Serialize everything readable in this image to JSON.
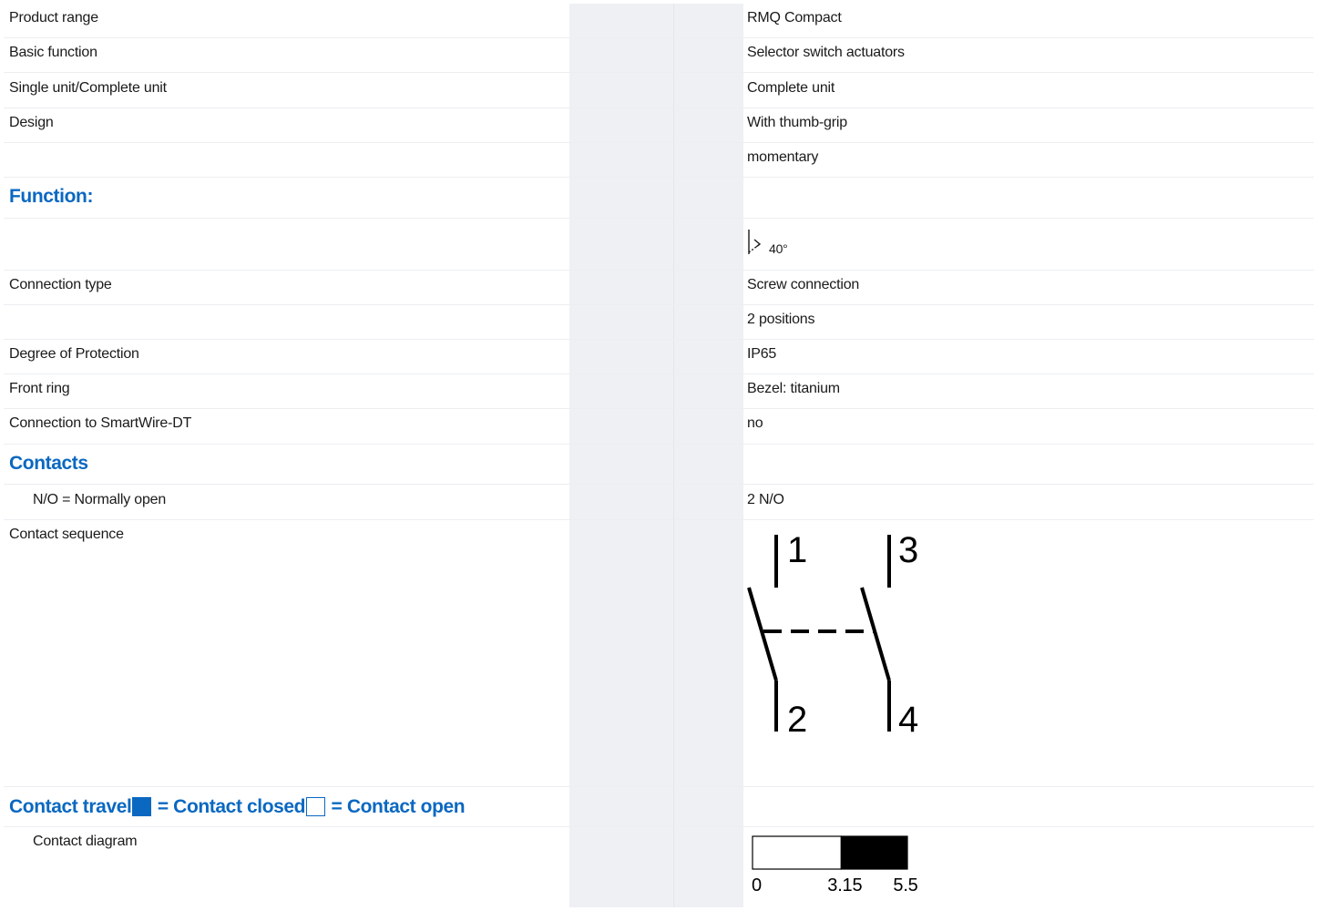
{
  "rows": {
    "product_range": {
      "label": "Product range",
      "value": "RMQ Compact"
    },
    "basic_function": {
      "label": "Basic function",
      "value": "Selector switch actuators"
    },
    "unit": {
      "label": "Single unit/Complete unit",
      "value": "Complete unit"
    },
    "design": {
      "label": "Design",
      "value": "With thumb-grip"
    },
    "design_extra": {
      "label": "",
      "value": "momentary"
    },
    "function_heading": "Function:",
    "function_icon": {
      "icon": "selector-switch-icon",
      "angle_label": "40°"
    },
    "connection_type": {
      "label": "Connection type",
      "value": "Screw connection"
    },
    "positions": {
      "label": "",
      "value": "2 positions"
    },
    "protection": {
      "label": "Degree of Protection",
      "value": "IP65"
    },
    "front_ring": {
      "label": "Front ring",
      "value": "Bezel: titanium"
    },
    "smartwire": {
      "label": "Connection to SmartWire-DT",
      "value": "no"
    },
    "contacts_heading": "Contacts",
    "normally_open": {
      "label": "N/O = Normally open",
      "value": "2 N/O"
    },
    "contact_sequence": {
      "label": "Contact sequence",
      "terminals": [
        "1",
        "2",
        "3",
        "4"
      ]
    },
    "contact_travel": {
      "title": "Contact travel",
      "closed_text": " = Contact closed",
      "open_text": " = Contact open"
    },
    "contact_diagram": {
      "label": "Contact diagram",
      "ticks": [
        "0",
        "3.15",
        "5.5"
      ],
      "open_from": 0,
      "closed_from": 3.15,
      "end": 5.5
    }
  },
  "colors": {
    "accent": "#0a68c1",
    "gap_column": "#eef0f4",
    "row_divider": "#eceef1"
  }
}
